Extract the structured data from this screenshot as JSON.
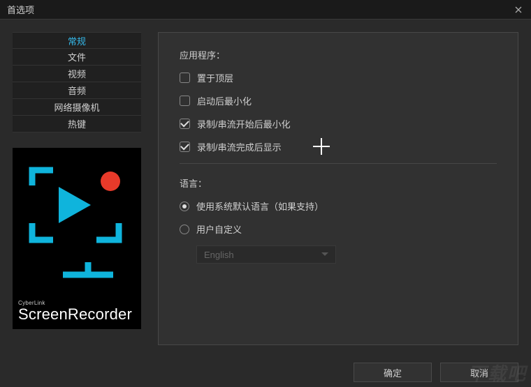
{
  "window": {
    "title": "首选项"
  },
  "sidebar": {
    "tabs": [
      {
        "label": "常规",
        "active": true
      },
      {
        "label": "文件",
        "active": false
      },
      {
        "label": "视频",
        "active": false
      },
      {
        "label": "音频",
        "active": false
      },
      {
        "label": "网络摄像机",
        "active": false
      },
      {
        "label": "热键",
        "active": false
      }
    ],
    "logo": {
      "brand": "CyberLink",
      "name": "ScreenRecorder"
    }
  },
  "content": {
    "app_section": {
      "label": "应用程序：",
      "options": [
        {
          "label": "置于顶层",
          "checked": false
        },
        {
          "label": "启动后最小化",
          "checked": false
        },
        {
          "label": "录制/串流开始后最小化",
          "checked": true
        },
        {
          "label": "录制/串流完成后显示",
          "checked": true
        }
      ]
    },
    "lang_section": {
      "label": "语言：",
      "options": [
        {
          "label": "使用系统默认语言（如果支持）",
          "checked": true
        },
        {
          "label": "用户自定义",
          "checked": false
        }
      ],
      "select_value": "English"
    }
  },
  "footer": {
    "ok": "确定",
    "cancel": "取消"
  },
  "watermark": "下载吧"
}
